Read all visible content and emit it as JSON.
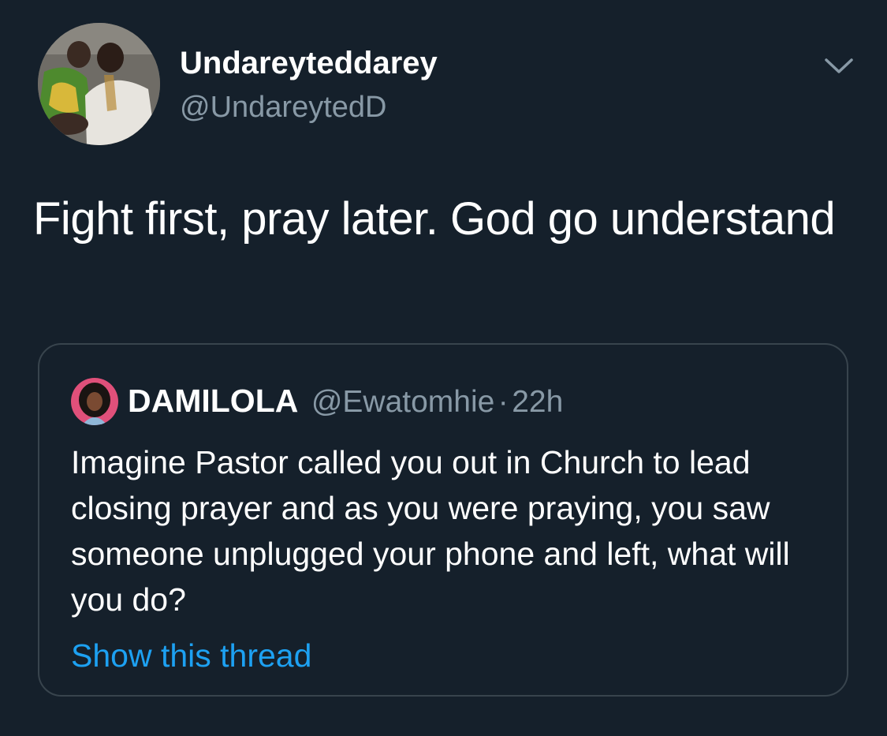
{
  "tweet": {
    "author": {
      "display_name": "Undareyteddarey",
      "handle": "@UndareytedD",
      "avatar_icon": "profile-photo-avatar"
    },
    "more_icon": "chevron-down-icon",
    "text": "Fight first, pray later. God go understand",
    "quoted": {
      "author": {
        "display_name": "DAMILOLA",
        "handle": "@Ewatomhie",
        "separator": "·",
        "time": "22h",
        "avatar_icon": "profile-photo-avatar"
      },
      "text": "Imagine Pastor called you out in Church to lead closing prayer and as you were praying, you saw someone unplugged your phone and left, what will you do?",
      "show_thread_label": "Show this thread"
    }
  },
  "colors": {
    "background": "#15202b",
    "text_primary": "#ffffff",
    "text_secondary": "#8899a6",
    "link": "#1da1f2",
    "border": "#38444d"
  }
}
